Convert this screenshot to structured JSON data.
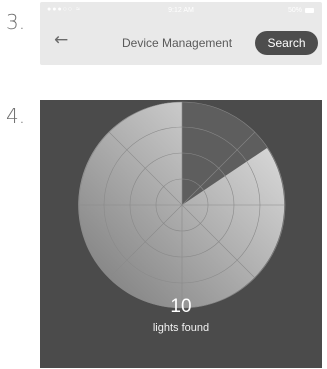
{
  "steps": {
    "step3": "3.",
    "step4": "4."
  },
  "status_bar": {
    "signal": "●●●○○",
    "wifi": "wifi-icon",
    "time": "9:12 AM",
    "battery_pct": "50%",
    "battery_icon": "battery-icon"
  },
  "header": {
    "back_icon": "back-arrow-icon",
    "back_glyph": "←",
    "title": "Device Management",
    "search_label": "Search"
  },
  "radar": {
    "lights_count": "10",
    "lights_label": "lights found",
    "sweep_colors": [
      "#ececec",
      "#777777"
    ]
  },
  "colors": {
    "header_bg": "#e9e9e9",
    "search_btn": "#4d4d4d",
    "panel_bg": "#4b4b4b",
    "radar_base": "#5e5e5e"
  }
}
